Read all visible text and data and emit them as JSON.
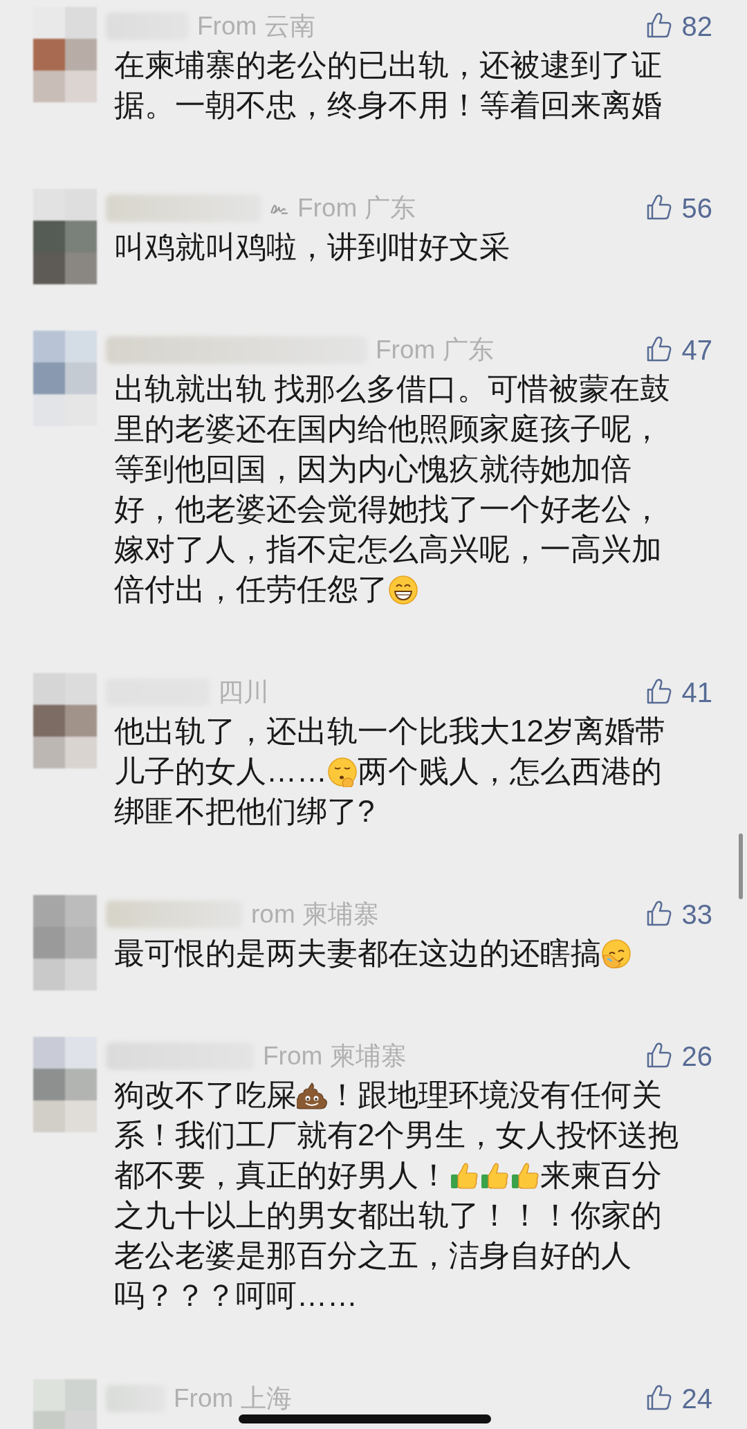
{
  "comments": [
    {
      "location": "From 云南",
      "tag_icon": false,
      "likes": "82",
      "parts": [
        {
          "kind": "text",
          "text": "在柬埔寨的老公的已出轨，还被逮到了证据。一朝不忠，终身不用！等着回来离婚"
        }
      ]
    },
    {
      "location": "From 广东",
      "tag_icon": true,
      "likes": "56",
      "parts": [
        {
          "kind": "text",
          "text": "叫鸡就叫鸡啦，讲到咁好文采"
        }
      ]
    },
    {
      "location": "From 广东",
      "tag_icon": false,
      "likes": "47",
      "parts": [
        {
          "kind": "text",
          "text": "出轨就出轨 找那么多借口。可惜被蒙在鼓里的老婆还在国内给他照顾家庭孩子呢，等到他回国，因为内心愧疚就待她加倍好，他老婆还会觉得她找了一个好老公，嫁对了人，指不定怎么高兴呢，一高兴加倍付出，任劳任怨了"
        },
        {
          "kind": "grin"
        }
      ]
    },
    {
      "location": "四川",
      "tag_icon": false,
      "likes": "41",
      "parts": [
        {
          "kind": "text",
          "text": "他出轨了，还出轨一个比我大12岁离婚带儿子的女人……"
        },
        {
          "kind": "hush"
        },
        {
          "kind": "text",
          "text": "两个贱人，怎么西港的绑匪不把他们绑了?"
        }
      ]
    },
    {
      "location": "rom 柬埔寨",
      "tag_icon": false,
      "likes": "33",
      "parts": [
        {
          "kind": "text",
          "text": "最可恨的是两夫妻都在这边的还瞎搞"
        },
        {
          "kind": "facepalm"
        }
      ]
    },
    {
      "location": "From 柬埔寨",
      "tag_icon": false,
      "likes": "26",
      "parts": [
        {
          "kind": "text",
          "text": "狗改不了吃屎"
        },
        {
          "kind": "poop"
        },
        {
          "kind": "text",
          "text": "！跟地理环境没有任何关系！我们工厂就有2个男生，女人投怀送抱都不要，真正的好男人！"
        },
        {
          "kind": "thumbsup"
        },
        {
          "kind": "thumbsup"
        },
        {
          "kind": "thumbsup"
        },
        {
          "kind": "text",
          "text": "来柬百分之九十以上的男女都出轨了！！！你家的老公老婆是那百分之五，洁身自好的人吗？？？呵呵……"
        }
      ]
    },
    {
      "location": "From 上海",
      "tag_icon": false,
      "likes": "24"
    }
  ]
}
